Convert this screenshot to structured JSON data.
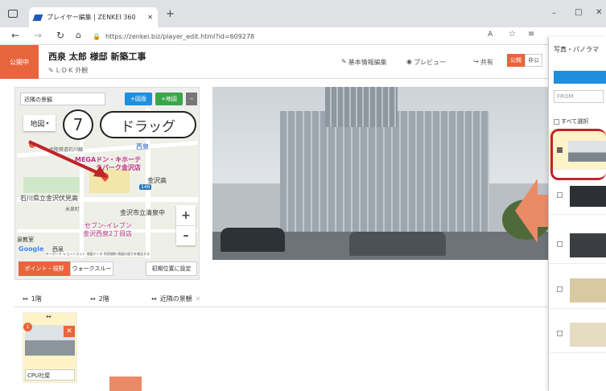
{
  "browser": {
    "tab_title": "プレイヤー編集 | ZENKEI 360",
    "url": "https://zenkei.biz/player_edit.html?id=609278",
    "new_tab": "+",
    "win_min": "–",
    "win_max": "□",
    "win_close": "✕"
  },
  "app": {
    "status_badge": "公開中",
    "project_title": "西泉 太郎 様邸 新築工事",
    "subtitle": "L·D·K 外観",
    "btn_basic_info": "基本情報編集",
    "btn_preview": "プレビュー",
    "btn_share": "共有",
    "btn_public": "公開",
    "btn_private": "非公"
  },
  "map_panel": {
    "scene_name": "近隣の景観",
    "btn_add_floor": "+図面",
    "btn_add_map": "+地図",
    "btn_minus": "–",
    "map_type": "地図",
    "map_labels": {
      "line": "北陸鉄道石川線",
      "mega": "MEGAドン・キホーテ",
      "mega2": "ラパーク金沢店",
      "saisen": "西泉",
      "kanazawa": "金沢高",
      "fushimi": "石川県立金沢伏見高",
      "yoneizumi": "米泉町",
      "seisen_ch": "金沢市立清泉中",
      "seven": "セブン-イレブン",
      "seven2": "金沢西泉2丁目店",
      "kyoushitsu": "泉教室",
      "nishiizumi": "西泉",
      "shortcut": "キーボード ショートカット  地図データ  利用規約  地図の誤りを報告する",
      "google": "Google",
      "num_146": "146"
    },
    "zoom_in": "+",
    "zoom_out": "–",
    "tab_point": "ポイント・視野",
    "tab_walk": "ウォークスルー",
    "btn_initial": "初期位置に設定"
  },
  "callout": {
    "number": "7",
    "label": "ドラッグ"
  },
  "floors": {
    "tab1": "1階",
    "tab2": "2階",
    "tab3": "近隣の景観",
    "close": "✕"
  },
  "scene_card": {
    "badge": "1",
    "label": "CPU社屋",
    "close": "✕"
  },
  "side_panel": {
    "title": "写真・パノラマ",
    "from_label": "FROM",
    "select_all": "すべて選択"
  },
  "colors": {
    "accent_orange": "#e8643c",
    "callout_red": "#c0242a",
    "blue": "#1e8fdc",
    "green": "#3aa64a"
  }
}
